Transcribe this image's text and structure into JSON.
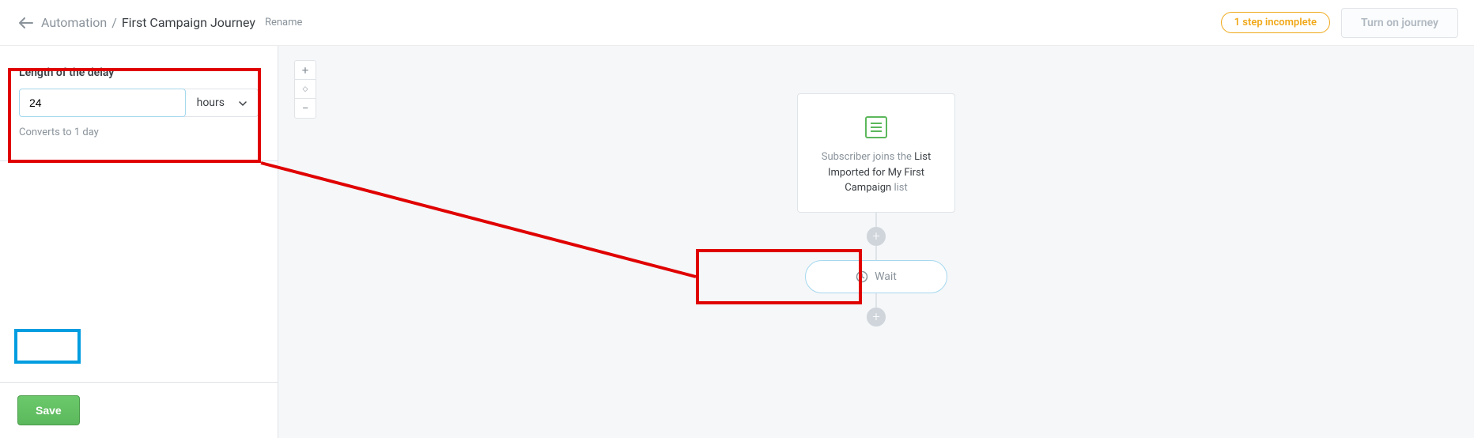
{
  "header": {
    "breadcrumb_root": "Automation",
    "breadcrumb_current": "First Campaign Journey",
    "rename_label": "Rename",
    "warning_pill": "1 step incomplete",
    "turn_on_label": "Turn on journey"
  },
  "sidebar": {
    "form_label": "Length of the delay",
    "delay_value": "24",
    "delay_unit": "hours",
    "help_text": "Converts to 1 day",
    "save_label": "Save"
  },
  "canvas": {
    "trigger_node": {
      "prefix": "Subscriber joins the ",
      "list_name": "List Imported for My First Campaign",
      "suffix": " list"
    },
    "wait_node_label": "Wait"
  }
}
